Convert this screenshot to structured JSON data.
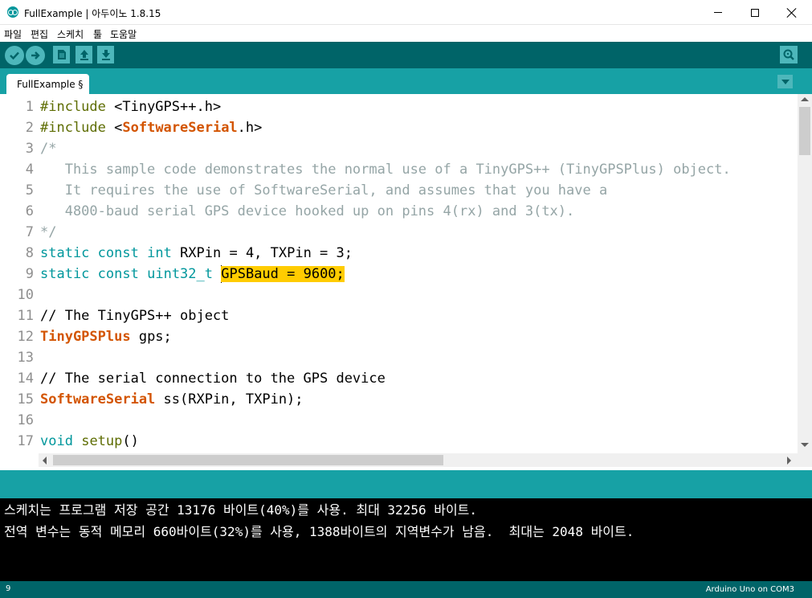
{
  "window": {
    "title": "FullExample | 아두이노 1.8.15"
  },
  "menu": {
    "items": [
      "파일",
      "편집",
      "스케치",
      "툴",
      "도움말"
    ]
  },
  "toolbar": {
    "icons": [
      "verify-icon",
      "upload-icon",
      "new-icon",
      "open-icon",
      "save-icon",
      "serial-monitor-icon"
    ]
  },
  "tabs": [
    {
      "label": "FullExample §"
    }
  ],
  "editor": {
    "line_numbers": [
      "1",
      "2",
      "3",
      "4",
      "5",
      "6",
      "7",
      "8",
      "9",
      "10",
      "11",
      "12",
      "13",
      "14",
      "15",
      "16",
      "17"
    ],
    "lines": [
      {
        "segments": [
          {
            "t": "#include",
            "c": "pre"
          },
          {
            "t": " <TinyGPS++.h>",
            "c": ""
          }
        ]
      },
      {
        "segments": [
          {
            "t": "#include",
            "c": "pre"
          },
          {
            "t": " <",
            "c": ""
          },
          {
            "t": "SoftwareSerial",
            "c": "cls"
          },
          {
            "t": ".h>",
            "c": ""
          }
        ]
      },
      {
        "segments": [
          {
            "t": "/*",
            "c": "com"
          }
        ]
      },
      {
        "segments": [
          {
            "t": "   This sample code demonstrates the normal use of a TinyGPS++ (TinyGPSPlus) object.",
            "c": "com"
          }
        ]
      },
      {
        "segments": [
          {
            "t": "   It requires the use of SoftwareSerial, and assumes that you have a",
            "c": "com"
          }
        ]
      },
      {
        "segments": [
          {
            "t": "   4800-baud serial GPS device hooked up on pins 4(rx) and 3(tx).",
            "c": "com"
          }
        ]
      },
      {
        "segments": [
          {
            "t": "*/",
            "c": "com"
          }
        ]
      },
      {
        "segments": [
          {
            "t": "static",
            "c": "kw"
          },
          {
            "t": " ",
            "c": ""
          },
          {
            "t": "const",
            "c": "kw"
          },
          {
            "t": " ",
            "c": ""
          },
          {
            "t": "int",
            "c": "kw"
          },
          {
            "t": " RXPin = 4, TXPin = 3;",
            "c": ""
          }
        ]
      },
      {
        "segments": [
          {
            "t": "static",
            "c": "kw"
          },
          {
            "t": " ",
            "c": ""
          },
          {
            "t": "const",
            "c": "kw"
          },
          {
            "t": " ",
            "c": ""
          },
          {
            "t": "uint32_t",
            "c": "kw"
          },
          {
            "t": " ",
            "c": ""
          },
          {
            "t": "|",
            "c": "caret"
          },
          {
            "t": "GPSBaud = 9600;",
            "c": "hl"
          }
        ]
      },
      {
        "segments": []
      },
      {
        "segments": [
          {
            "t": "// The TinyGPS++ object",
            "c": ""
          }
        ]
      },
      {
        "segments": [
          {
            "t": "TinyGPSPlus",
            "c": "cls"
          },
          {
            "t": " gps;",
            "c": ""
          }
        ]
      },
      {
        "segments": []
      },
      {
        "segments": [
          {
            "t": "// The serial connection to the GPS device",
            "c": ""
          }
        ]
      },
      {
        "segments": [
          {
            "t": "SoftwareSerial",
            "c": "cls"
          },
          {
            "t": " ss(RXPin, TXPin);",
            "c": ""
          }
        ]
      },
      {
        "segments": []
      },
      {
        "segments": [
          {
            "t": "void",
            "c": "kw"
          },
          {
            "t": " ",
            "c": ""
          },
          {
            "t": "setup",
            "c": "fn"
          },
          {
            "t": "()",
            "c": ""
          }
        ]
      }
    ]
  },
  "console": {
    "lines": [
      "스케치는 프로그램 저장 공간 13176 바이트(40%)를 사용. 최대 32256 바이트.",
      "전역 변수는 동적 메모리 660바이트(32%)를 사용, 1388바이트의 지역변수가 남음.  최대는 2048 바이트."
    ]
  },
  "footer": {
    "line": "9",
    "board": "Arduino Uno on COM3"
  },
  "colors": {
    "toolbar_bg": "#006468",
    "tabbar_bg": "#17a1a5",
    "button_bg": "#4db7bb",
    "keyword": "#00979c",
    "class": "#d35400",
    "comment": "#95a5a6",
    "highlight": "#ffcc00"
  }
}
